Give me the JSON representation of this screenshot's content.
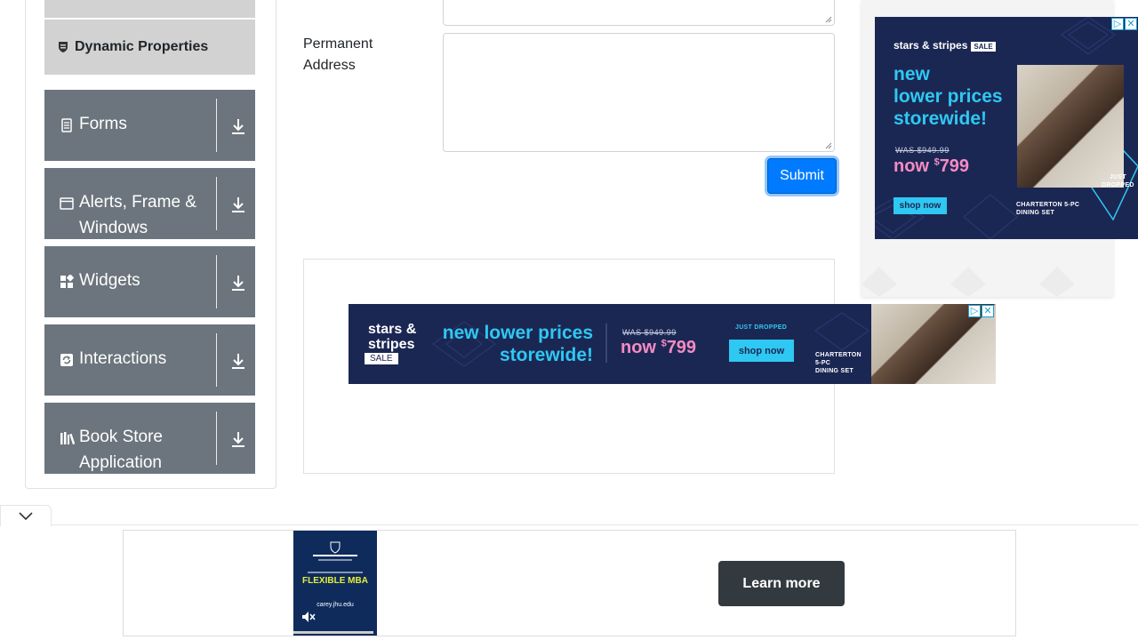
{
  "sidebar": {
    "active_item": {
      "label": "Dynamic Properties",
      "icon": "shield-icon"
    },
    "groups": [
      {
        "label": "Forms",
        "icon": "form-doc-icon"
      },
      {
        "label_line1": "Alerts, Frame &",
        "label_line2": "Windows",
        "icon": "window-icon"
      },
      {
        "label": "Widgets",
        "icon": "widgets-grid-icon"
      },
      {
        "label": "Interactions",
        "icon": "refresh-icon"
      },
      {
        "label_line1": "Book Store",
        "label_line2": "Application",
        "icon": "books-icon"
      }
    ]
  },
  "form": {
    "permanent_address_label_line1": "Permanent",
    "permanent_address_label_line2": "Address",
    "submit_label": "Submit",
    "primary_color": "#007bff"
  },
  "ad_right": {
    "brand": "stars & stripes",
    "sale": "SALE",
    "headline_line1": "new",
    "headline_line2": "lower prices",
    "headline_line3": "storewide!",
    "was_price": "WAS $949.99",
    "now_prefix": "now",
    "now_dollar": "$",
    "now_price": "799",
    "shop_now": "shop now",
    "product_line1": "CHARTERTON 5-PC",
    "product_line2": "DINING SET",
    "badge_line1": "JUST",
    "badge_line2": "DROPPED"
  },
  "ad_banner": {
    "brand_line1": "stars &",
    "brand_line2": "stripes",
    "sale": "SALE",
    "headline_line1": "new lower prices",
    "headline_line2": "storewide!",
    "was_price": "WAS $949.99",
    "now_prefix": "now",
    "now_dollar": "$",
    "now_price": "799",
    "just_dropped": "JUST DROPPED",
    "shop_now": "shop now",
    "product_line1": "CHARTERTON",
    "product_line2": "5-PC",
    "product_line3": "DINING SET"
  },
  "bottom_ad": {
    "learn_more": "Learn more",
    "mba_title": "FLEXIBLE MBA",
    "mba_url": "carey.jhu.edu"
  }
}
